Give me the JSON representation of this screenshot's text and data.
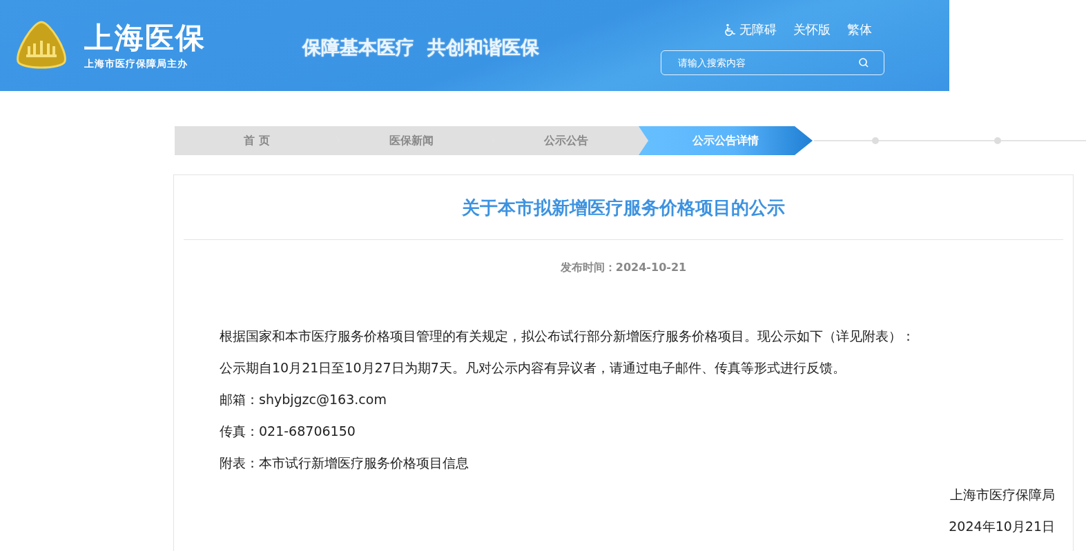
{
  "header": {
    "site_name": "上海医保",
    "site_subtitle": "上海市医疗保障局主办",
    "slogan": "保障基本医疗  共创和谐医保",
    "top_links": [
      {
        "label": "无障碍",
        "kind": "accessibility"
      },
      {
        "label": "关怀版",
        "kind": "plain"
      },
      {
        "label": "繁体",
        "kind": "plain"
      }
    ],
    "search": {
      "placeholder": "请输入搜索内容"
    }
  },
  "breadcrumb": [
    {
      "label": "首 页",
      "selected": false
    },
    {
      "label": "医保新闻",
      "selected": false
    },
    {
      "label": "公示公告",
      "selected": false
    },
    {
      "label": "公示公告详情",
      "selected": true
    }
  ],
  "article": {
    "title": "关于本市拟新增医疗服务价格项目的公示",
    "publish_time": "发布时间：2024-10-21",
    "paragraphs": [
      "根据国家和本市医疗服务价格项目管理的有关规定，拟公布试行部分新增医疗服务价格项目。现公示如下（详见附表）：",
      "公示期自10月21日至10月27日为期7天。凡对公示内容有异议者，请通过电子邮件、传真等形式进行反馈。",
      "邮箱：shybjgzc@163.com",
      "传真：021-68706150",
      "附表：本市试行新增医疗服务价格项目信息"
    ],
    "signature": [
      "上海市医疗保障局",
      "2024年10月21日"
    ]
  }
}
